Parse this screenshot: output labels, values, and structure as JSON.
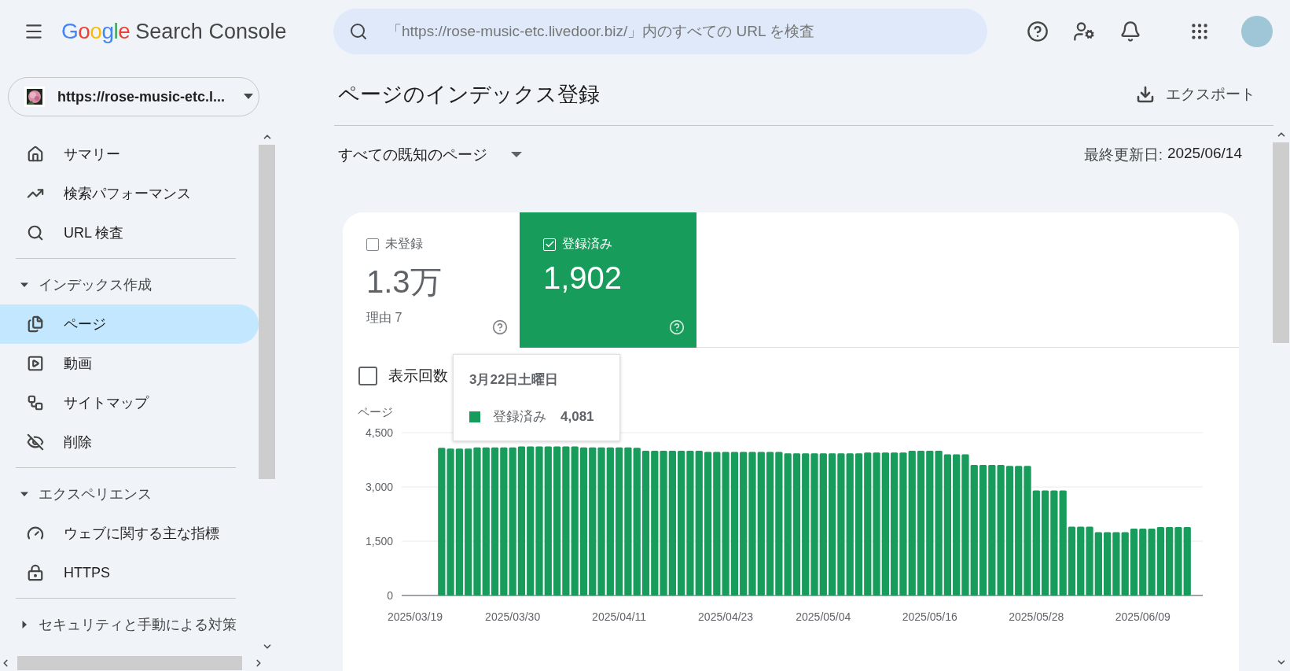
{
  "header": {
    "brand": "Google",
    "product": "Search Console",
    "search": {
      "placeholder": "「https://rose-music-etc.livedoor.biz/」内のすべての URL を検査"
    }
  },
  "sidebar": {
    "property": "https://rose-music-etc.l...",
    "sections": [
      {
        "items": [
          {
            "label": "サマリー",
            "selected": false
          },
          {
            "label": "検索パフォーマンス",
            "selected": false
          },
          {
            "label": "URL 検査",
            "selected": false
          }
        ]
      },
      {
        "title": "インデックス作成",
        "expanded": true,
        "items": [
          {
            "label": "ページ",
            "selected": true
          },
          {
            "label": "動画",
            "selected": false
          },
          {
            "label": "サイトマップ",
            "selected": false
          },
          {
            "label": "削除",
            "selected": false
          }
        ]
      },
      {
        "title": "エクスペリエンス",
        "expanded": true,
        "items": [
          {
            "label": "ウェブに関する主な指標",
            "selected": false
          },
          {
            "label": "HTTPS",
            "selected": false
          }
        ]
      },
      {
        "title": "セキュリティと手動による対策",
        "expanded": false
      }
    ]
  },
  "page": {
    "title": "ページのインデックス登録",
    "export": "エクスポート",
    "filter": "すべての既知のページ",
    "updated_label": "最終更新日:",
    "updated_value": "2025/06/14",
    "tiles": [
      {
        "label": "未登録",
        "value": "1.3万",
        "note": "理由 7",
        "checked": false
      },
      {
        "label": "登録済み",
        "value": "1,902",
        "checked": true
      }
    ],
    "impressions": {
      "label": "表示回数",
      "checked": false
    },
    "tooltip": {
      "title": "3月22日土曜日",
      "value": "4,081"
    },
    "chart_data": {
      "type": "bar",
      "ylabel": "ページ",
      "categories": [
        "2025/03/19",
        null,
        null,
        null,
        null,
        null,
        null,
        null,
        null,
        null,
        null,
        "2025/03/30",
        null,
        null,
        null,
        null,
        null,
        null,
        null,
        null,
        null,
        null,
        null,
        "2025/04/11",
        null,
        null,
        null,
        null,
        null,
        null,
        null,
        null,
        null,
        null,
        null,
        "2025/04/23",
        null,
        null,
        null,
        null,
        null,
        null,
        null,
        null,
        null,
        null,
        "2025/05/04",
        null,
        null,
        null,
        null,
        null,
        null,
        null,
        null,
        null,
        null,
        null,
        "2025/05/16",
        null,
        null,
        null,
        null,
        null,
        null,
        null,
        null,
        null,
        null,
        null,
        "2025/05/28",
        null,
        null,
        null,
        null,
        null,
        null,
        null,
        null,
        null,
        null,
        null,
        "2025/06/09",
        null,
        null,
        null,
        null,
        null
      ],
      "series": [
        {
          "name": "登録済み",
          "color": "#179c5b",
          "values": [
            null,
            null,
            null,
            4080,
            4060,
            4060,
            4060,
            4090,
            4090,
            4090,
            4090,
            4090,
            4120,
            4120,
            4120,
            4120,
            4120,
            4120,
            4120,
            4090,
            4090,
            4090,
            4090,
            4090,
            4090,
            4080,
            4000,
            4000,
            4000,
            4000,
            4000,
            4000,
            4000,
            3970,
            3970,
            3970,
            3970,
            3970,
            3970,
            3970,
            3970,
            3970,
            3930,
            3930,
            3930,
            3930,
            3930,
            3930,
            3930,
            3930,
            3930,
            3950,
            3950,
            3950,
            3950,
            3950,
            4000,
            4000,
            4000,
            4000,
            3900,
            3900,
            3900,
            3610,
            3610,
            3610,
            3610,
            3580,
            3580,
            3580,
            2900,
            2900,
            2900,
            2900,
            1900,
            1900,
            1900,
            1750,
            1750,
            1750,
            1750,
            1850,
            1850,
            1850,
            1890,
            1890,
            1890,
            1890
          ]
        }
      ],
      "ylim": [
        0,
        4500
      ],
      "yticks": [
        {
          "value": 0,
          "label": "0"
        },
        {
          "value": 1500,
          "label": "1,500"
        },
        {
          "value": 3000,
          "label": "3,000"
        },
        {
          "value": 4500,
          "label": "4,500"
        }
      ]
    }
  }
}
